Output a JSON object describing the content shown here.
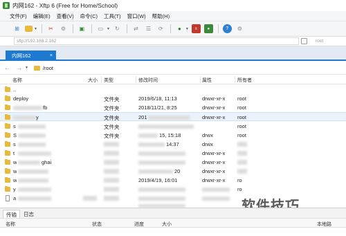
{
  "window": {
    "title": "内网162 - Xftp 6 (Free for Home/School)"
  },
  "menu": [
    "文件(F)",
    "编辑(E)",
    "查看(V)",
    "命令(C)",
    "工具(T)",
    "窗口(W)",
    "帮助(H)"
  ],
  "address": {
    "value": "sftp://192.168.2.162",
    "user": "root"
  },
  "session_tab": {
    "label": "内网162",
    "close": "×"
  },
  "path": {
    "current": "/root"
  },
  "columns": {
    "name": "名称",
    "size": "大小",
    "type": "类型",
    "modified": "修改时间",
    "attr": "属性",
    "owner": "所有者"
  },
  "files": [
    {
      "name": "..",
      "type": "",
      "modified": "",
      "attr": "",
      "owner": "",
      "kind": "folder"
    },
    {
      "name": "deploy",
      "type": "文件夹",
      "modified": "2019/6/18, 11:13",
      "attr": "drwxr-xr-x",
      "owner": "root",
      "kind": "folder"
    },
    {
      "name": "fb",
      "type": "文件夹",
      "modified": "2018/11/21, 8:25",
      "attr": "drwxr-xr-x",
      "owner": "root",
      "kind": "folder"
    },
    {
      "name": "y",
      "type": "文件夹",
      "modified": "201",
      "attr": "drwxr-xr-x",
      "owner": "root",
      "kind": "folder"
    },
    {
      "name": "s",
      "type": "文件夹",
      "modified": "",
      "attr": "",
      "owner": "root",
      "kind": "folder"
    },
    {
      "name": "S",
      "type": "文件夹",
      "modified": "15, 15:18",
      "attr": "drwx",
      "owner": "root",
      "kind": "folder"
    },
    {
      "name": "s",
      "type": "",
      "modified": "14:37",
      "attr": "drwx",
      "owner": "",
      "kind": "folder"
    },
    {
      "name": "t",
      "type": "",
      "modified": "",
      "attr": "drwxr-xr-x",
      "owner": "",
      "kind": "folder"
    },
    {
      "name": "w",
      "type": "",
      "modified": "",
      "attr": "drwxr-xr-x",
      "owner": "",
      "kind": "folder"
    },
    {
      "name": "w",
      "type": "",
      "modified": "20",
      "attr": "drwxr-xr-x",
      "owner": "",
      "kind": "folder"
    },
    {
      "name": "w",
      "type": "",
      "modified": "2019/4/19, 16:01",
      "attr": "drwxr-xr-x",
      "owner": "ro",
      "kind": "folder"
    },
    {
      "name": "y",
      "type": "",
      "modified": "",
      "attr": "",
      "owner": "ro",
      "kind": "folder"
    },
    {
      "name": "a",
      "type": "",
      "modified": "",
      "attr": "",
      "owner": "",
      "kind": "file"
    }
  ],
  "partial_name": "ghai",
  "bottom_tabs": [
    "传输",
    "日志"
  ],
  "transfer_columns": {
    "name": "名称",
    "status": "状态",
    "progress": "进度",
    "size": "大小",
    "local": "本地路"
  },
  "watermark": "软件技巧",
  "colors": {
    "accent": "#1e7ad1",
    "folder": "#e9b93c",
    "selected_row": "#eaf2fb"
  }
}
